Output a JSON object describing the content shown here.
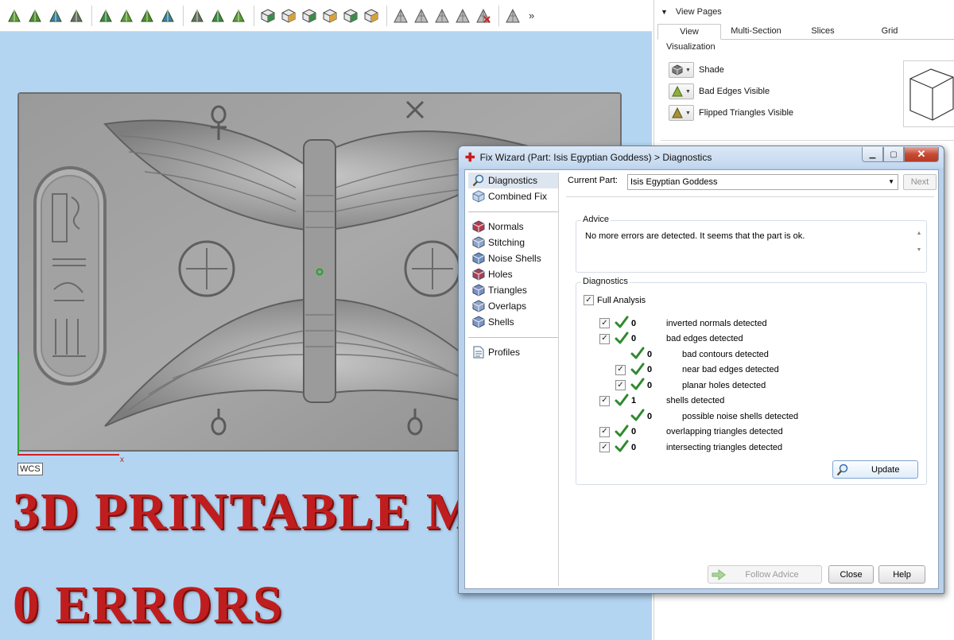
{
  "toolbar": {
    "icons": [
      "triangle-select-icon",
      "triangle-select-icon",
      "triangle-select-icon",
      "sphere-select-icon",
      "surface-select-icon",
      "surface-select-icon",
      "curve-select-icon",
      "shell-select-icon",
      "shell-select-icon",
      "shell-select-icon",
      "shell-select-icon",
      "cube-view-icon",
      "cube-view-icon",
      "cube-view-icon",
      "cube-view-icon",
      "cube-view-icon",
      "cube-view-icon",
      "mesh-tool-icon",
      "mesh-tool-icon",
      "mesh-tool-icon",
      "mesh-tool-icon",
      "delete-triangle-icon",
      "mesh-tool-icon"
    ],
    "more": "»"
  },
  "viewport": {
    "wcs": "WCS",
    "x_axis": "x",
    "overlay_line1": "3D PRINTABLE MODEL",
    "overlay_line2": "0 ERRORS"
  },
  "view_pages": {
    "title": "View Pages",
    "tabs": [
      "View",
      "Multi-Section",
      "Slices",
      "Grid"
    ],
    "group": "Visualization",
    "rows": [
      "Shade",
      "Bad Edges Visible",
      "Flipped Triangles Visible"
    ]
  },
  "dialog": {
    "title": "Fix Wizard (Part: Isis Egyptian Goddess) > Diagnostics",
    "nav_top": [
      "Diagnostics",
      "Combined Fix"
    ],
    "nav_mid": [
      "Normals",
      "Stitching",
      "Noise Shells",
      "Holes",
      "Triangles",
      "Overlaps",
      "Shells"
    ],
    "nav_bottom": [
      "Profiles"
    ],
    "current_part_label": "Current Part:",
    "current_part_value": "Isis Egyptian Goddess",
    "next": "Next",
    "advice_title": "Advice",
    "advice_text": "No more errors are detected. It seems that the part is ok.",
    "diagnostics_title": "Diagnostics",
    "full_analysis": "Full Analysis",
    "rows": [
      {
        "count": "0",
        "text": "inverted normals detected"
      },
      {
        "count": "0",
        "text": "bad edges detected"
      },
      {
        "count": "0",
        "text": "bad contours detected"
      },
      {
        "count": "0",
        "text": "near bad edges detected"
      },
      {
        "count": "0",
        "text": "planar holes detected"
      },
      {
        "count": "1",
        "text": "shells detected"
      },
      {
        "count": "0",
        "text": "possible noise shells detected"
      },
      {
        "count": "0",
        "text": "overlapping triangles detected"
      },
      {
        "count": "0",
        "text": "intersecting triangles detected"
      }
    ],
    "update": "Update",
    "follow_advice": "Follow Advice",
    "close": "Close",
    "help": "Help"
  },
  "colors": {
    "viewport_bg": "#b4d5f2",
    "overlay_text": "#c01e1e",
    "check_green": "#2f8a2f"
  }
}
